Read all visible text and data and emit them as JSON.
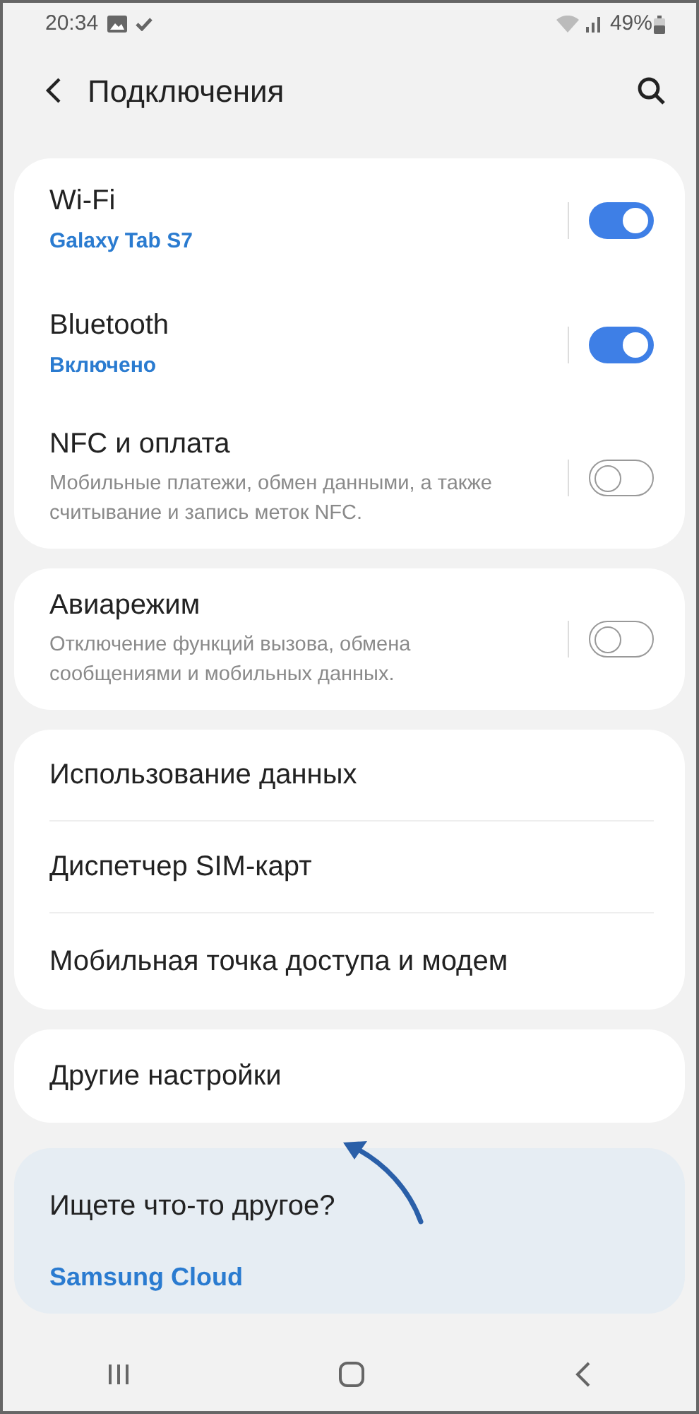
{
  "status_bar": {
    "time": "20:34",
    "battery": "49%"
  },
  "header": {
    "title": "Подключения"
  },
  "groups": [
    {
      "items": [
        {
          "kind": "toggle",
          "title": "Wi-Fi",
          "summary": "Galaxy Tab S7",
          "on": true
        },
        {
          "kind": "toggle",
          "title": "Bluetooth",
          "summary": "Включено",
          "on": true
        },
        {
          "kind": "toggle",
          "title": "NFC и оплата",
          "description": "Мобильные платежи, обмен данными, а также считывание и запись меток NFC.",
          "on": false
        }
      ]
    },
    {
      "items": [
        {
          "kind": "toggle",
          "title": "Авиарежим",
          "description": "Отключение функций вызова, обмена сообщениями и мобильных данных.",
          "on": false
        }
      ]
    },
    {
      "items": [
        {
          "kind": "link",
          "title": "Использование данных"
        },
        {
          "kind": "link",
          "title": "Диспетчер SIM-карт"
        },
        {
          "kind": "link",
          "title": "Мобильная точка доступа и модем"
        }
      ]
    },
    {
      "items": [
        {
          "kind": "link",
          "title": "Другие настройки"
        }
      ]
    }
  ],
  "suggestions": {
    "title": "Ищете что-то другое?",
    "links": [
      "Samsung Cloud"
    ]
  }
}
